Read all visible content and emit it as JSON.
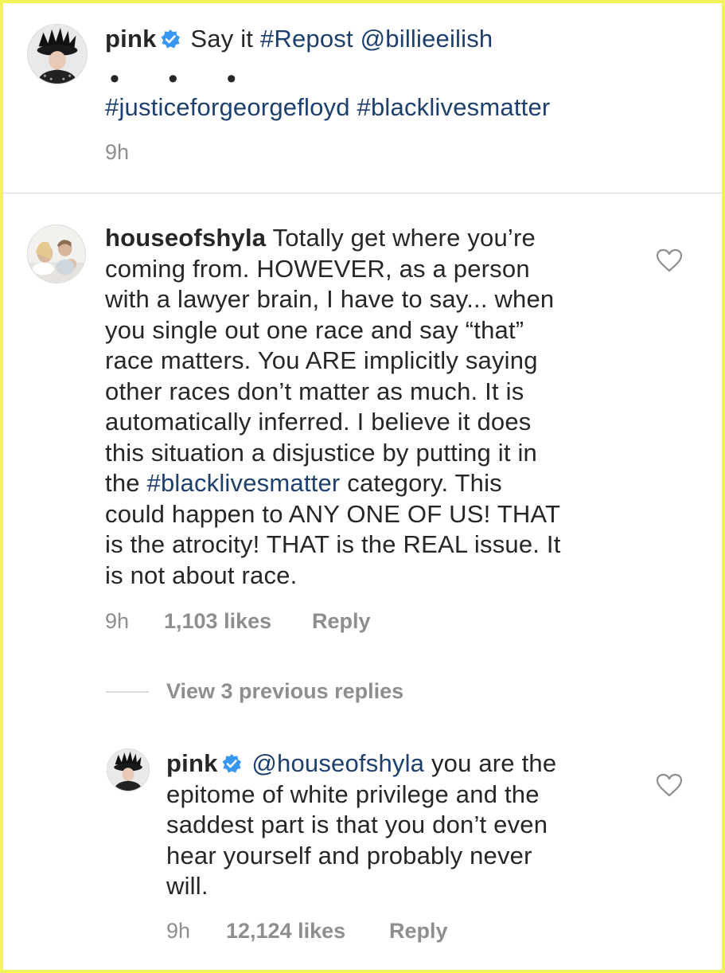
{
  "post": {
    "username": "pink",
    "caption_prefix": "Say it",
    "caption_tag_repost": "#Repost",
    "caption_mention": "@billieeilish",
    "dots": "• • •",
    "hashtag_1": "#justiceforgeorgefloyd",
    "hashtag_2": "#blacklivesmatter",
    "time": "9h"
  },
  "comment": {
    "username": "houseofshyla",
    "text_lines": [
      "Totally get where you’re",
      "coming from. HOWEVER, as a person",
      "with a lawyer brain, I have to say... when",
      "you single out one race and say “that”",
      "race matters. You ARE implicitly saying",
      "other races don’t matter as much. It is",
      "automatically inferred.  I believe it does",
      "this situation a disjustice by putting it in"
    ],
    "line9_prefix": "the",
    "line9_tag": "#blacklivesmatter",
    "line9_suffix": "category. This",
    "text_lines_end": [
      "could happen to ANY ONE OF US! THAT",
      "is the atrocity! THAT is the REAL issue. It",
      "is not about race."
    ],
    "time": "9h",
    "likes": "1,103 likes",
    "reply": "Reply",
    "view_replies": "View 3 previous replies"
  },
  "reply_comment": {
    "username": "pink",
    "mention": "@houseofshyla",
    "line1_suffix": "you are the",
    "text_lines": [
      "epitome of white privilege and the",
      "saddest part is that you don’t even",
      "hear yourself and probably never",
      "will."
    ],
    "time": "9h",
    "likes": "12,124 likes",
    "reply": "Reply"
  },
  "colors": {
    "hashtag": "#1c3f6e",
    "meta": "#8e8e8e",
    "verified": "#3897f0",
    "frame": "#f2f25a"
  }
}
